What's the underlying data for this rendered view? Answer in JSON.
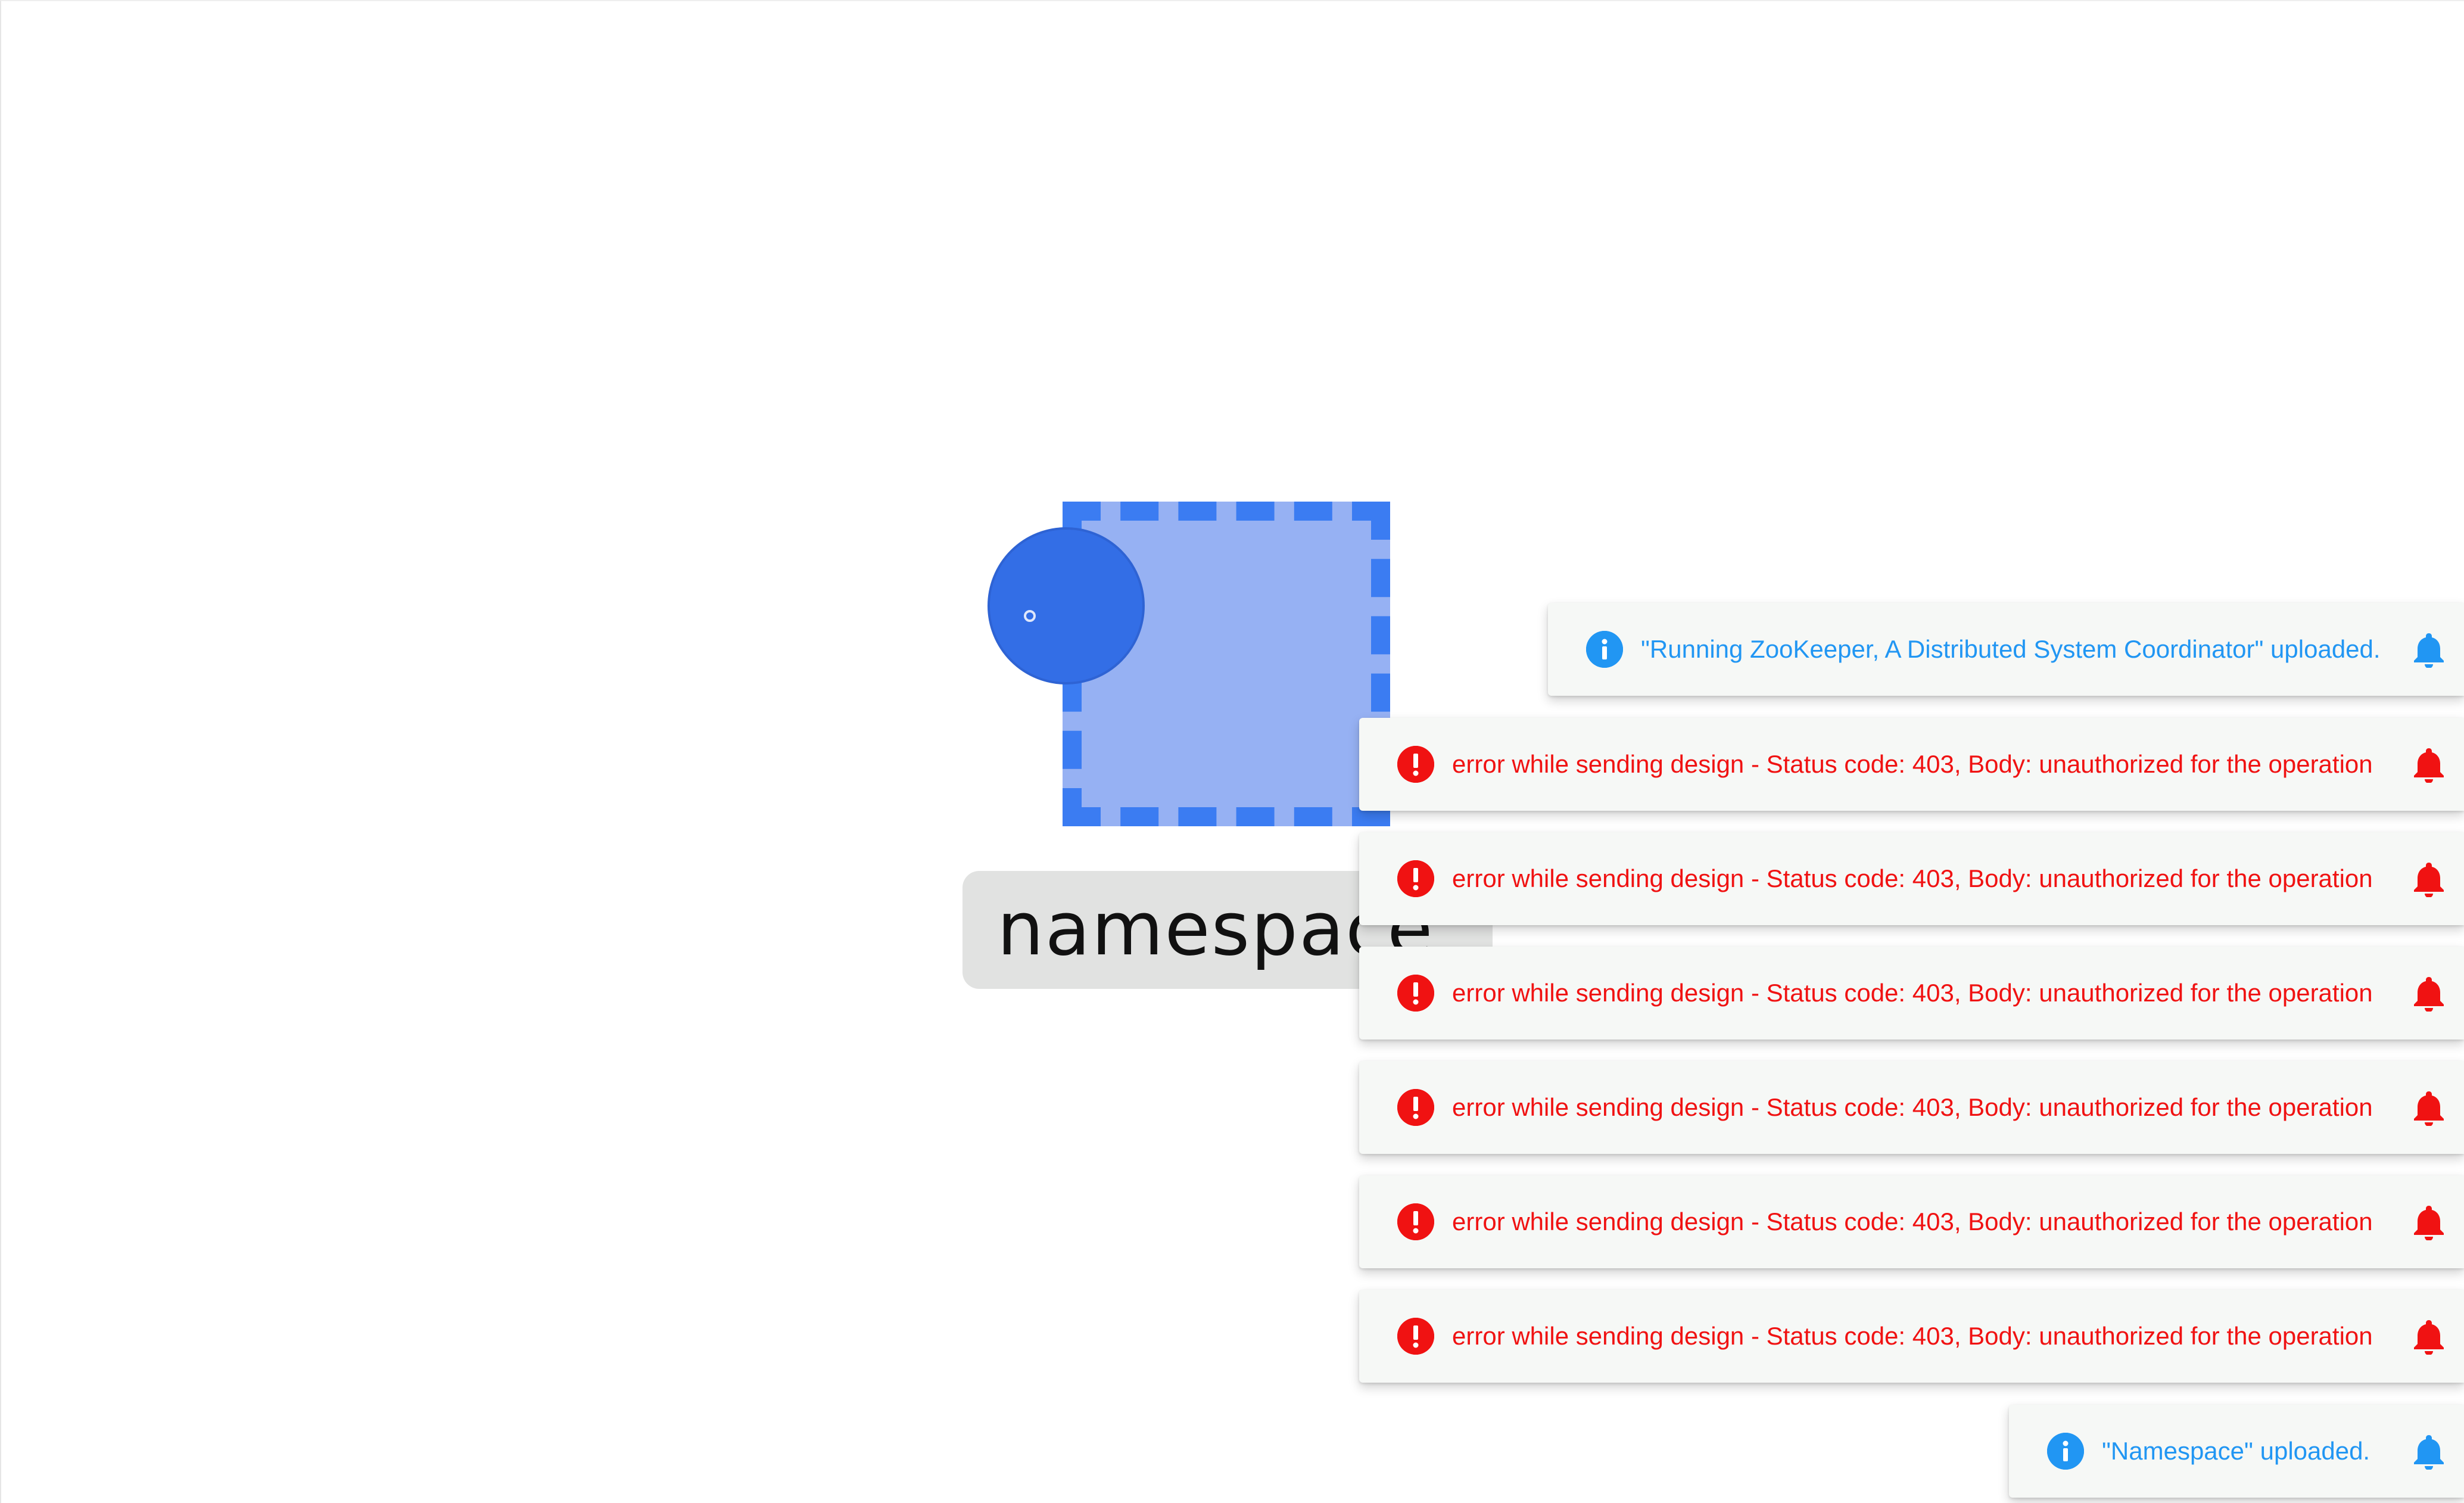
{
  "canvas": {
    "node": {
      "label": "namespace"
    }
  },
  "notifications": [
    {
      "type": "info",
      "message": "\"Running ZooKeeper, A Distributed System Coordinator\" uploaded.",
      "icon": "info-icon",
      "color": "#2196f3"
    },
    {
      "type": "error",
      "message": "error while sending design - Status code: 403, Body: unauthorized for the operation",
      "icon": "error-icon",
      "color": "#f01212"
    },
    {
      "type": "error",
      "message": "error while sending design - Status code: 403, Body: unauthorized for the operation",
      "icon": "error-icon",
      "color": "#f01212"
    },
    {
      "type": "error",
      "message": "error while sending design - Status code: 403, Body: unauthorized for the operation",
      "icon": "error-icon",
      "color": "#f01212"
    },
    {
      "type": "error",
      "message": "error while sending design - Status code: 403, Body: unauthorized for the operation",
      "icon": "error-icon",
      "color": "#f01212"
    },
    {
      "type": "error",
      "message": "error while sending design - Status code: 403, Body: unauthorized for the operation",
      "icon": "error-icon",
      "color": "#f01212"
    },
    {
      "type": "error",
      "message": "error while sending design - Status code: 403, Body: unauthorized for the operation",
      "icon": "error-icon",
      "color": "#f01212"
    },
    {
      "type": "info",
      "message": "\"Namespace\" uploaded.",
      "icon": "info-icon",
      "color": "#2196f3"
    }
  ]
}
